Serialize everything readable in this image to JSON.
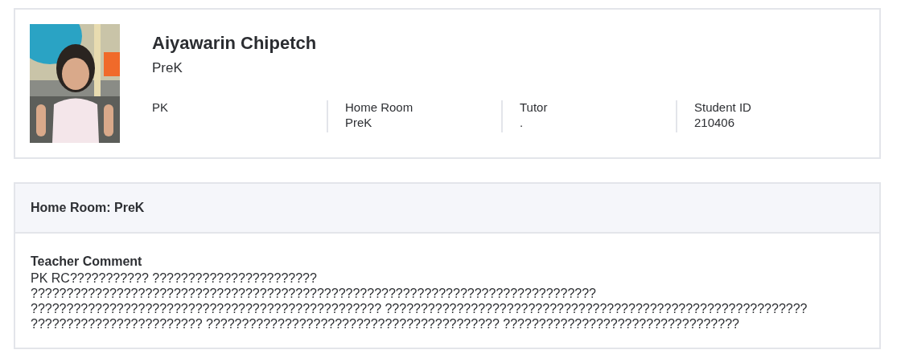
{
  "student": {
    "name": "Aiyawarin Chipetch",
    "grade": "PreK",
    "fields": [
      {
        "label": "PK"
      },
      {
        "label": "Home Room",
        "value": "PreK"
      },
      {
        "label": "Tutor",
        "value": "."
      },
      {
        "label": "Student ID",
        "value": "210406"
      }
    ]
  },
  "homeroom": {
    "title": "Home Room: PreK",
    "comment_label": "Teacher Comment",
    "comment": "PK RC??????????? ??????????????????????? ??????????????????????????????????????????????????????????????????????????????? ????????????????????????????????????????????????? ??????????????????????????????????????????????????????????? ???????????????????????? ????????????????????????????????????????? ?????????????????????????????????"
  }
}
